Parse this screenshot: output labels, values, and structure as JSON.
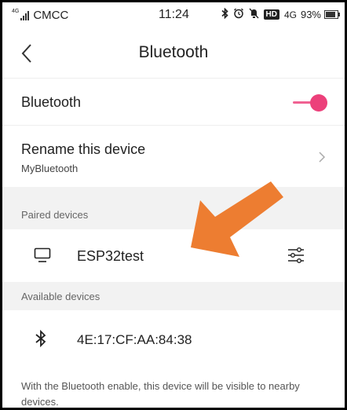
{
  "status_bar": {
    "signal_tag": "4G",
    "carrier": "CMCC",
    "time": "11:24",
    "hd_badge": "HD",
    "network": "4G",
    "battery": "93%"
  },
  "header": {
    "title": "Bluetooth"
  },
  "bluetooth_toggle": {
    "label": "Bluetooth",
    "enabled": true,
    "accent_color": "#ec407a"
  },
  "rename": {
    "label": "Rename this device",
    "device_name": "MyBluetooth"
  },
  "paired": {
    "header": "Paired devices",
    "devices": [
      {
        "name": "ESP32test",
        "icon": "monitor-icon"
      }
    ]
  },
  "available": {
    "header": "Available devices",
    "devices": [
      {
        "name": "4E:17:CF:AA:84:38",
        "icon": "bluetooth-icon"
      }
    ]
  },
  "footer": {
    "note": "With the Bluetooth enable, this device will be visible to nearby devices."
  },
  "overlay": {
    "arrow_color": "#ed7d31"
  }
}
